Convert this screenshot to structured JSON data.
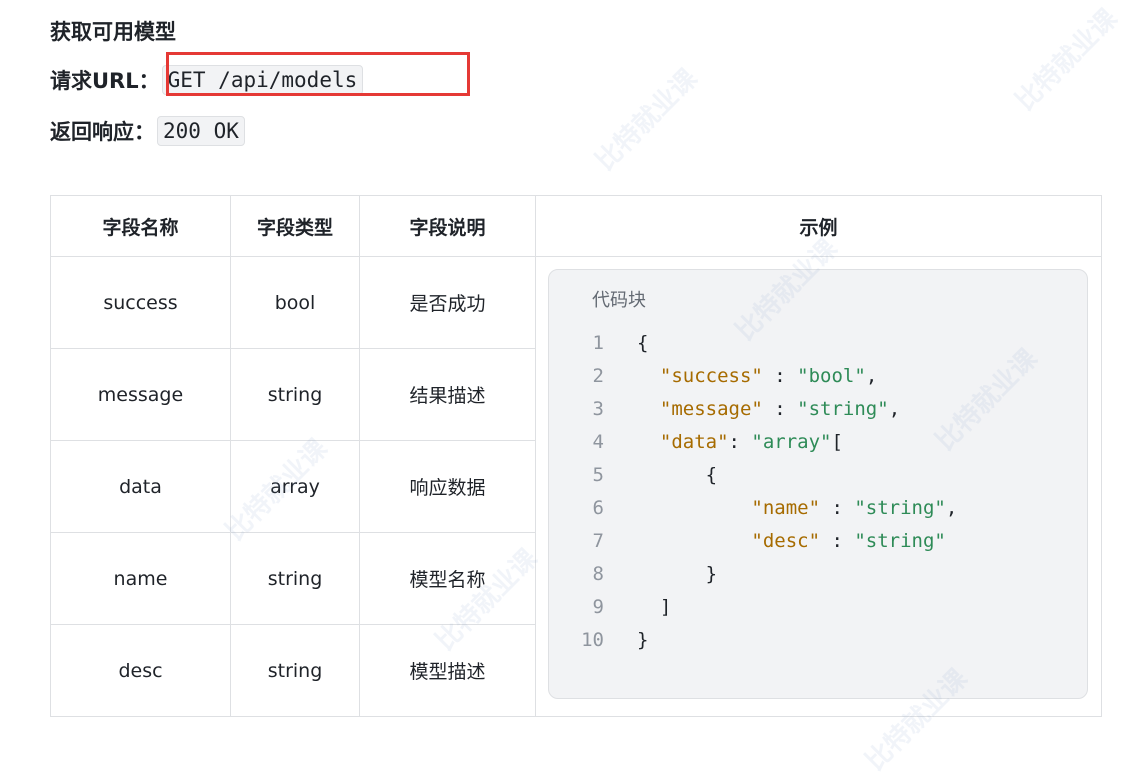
{
  "heading": "获取可用模型",
  "request": {
    "label": "请求URL：",
    "value": "GET /api/models"
  },
  "response": {
    "label": "返回响应：",
    "value": "200 OK"
  },
  "table": {
    "headers": [
      "字段名称",
      "字段类型",
      "字段说明",
      "示例"
    ],
    "rows": [
      [
        "success",
        "bool",
        "是否成功"
      ],
      [
        "message",
        "string",
        "结果描述"
      ],
      [
        "data",
        "array",
        "响应数据"
      ],
      [
        "name",
        "string",
        "模型名称"
      ],
      [
        "desc",
        "string",
        "模型描述"
      ]
    ]
  },
  "code_block": {
    "title": "代码块",
    "lines": [
      {
        "n": "1",
        "tokens": [
          {
            "t": "{",
            "c": "punc"
          }
        ]
      },
      {
        "n": "2",
        "tokens": [
          {
            "t": "  ",
            "c": "punc"
          },
          {
            "t": "\"success\"",
            "c": "str"
          },
          {
            "t": " : ",
            "c": "punc"
          },
          {
            "t": "\"bool\"",
            "c": "green"
          },
          {
            "t": ",",
            "c": "punc"
          }
        ]
      },
      {
        "n": "3",
        "tokens": [
          {
            "t": "  ",
            "c": "punc"
          },
          {
            "t": "\"message\"",
            "c": "str"
          },
          {
            "t": " : ",
            "c": "punc"
          },
          {
            "t": "\"string\"",
            "c": "green"
          },
          {
            "t": ",",
            "c": "punc"
          }
        ]
      },
      {
        "n": "4",
        "tokens": [
          {
            "t": "  ",
            "c": "punc"
          },
          {
            "t": "\"data\"",
            "c": "str"
          },
          {
            "t": ": ",
            "c": "punc"
          },
          {
            "t": "\"array\"",
            "c": "green"
          },
          {
            "t": "[",
            "c": "punc"
          }
        ]
      },
      {
        "n": "5",
        "tokens": [
          {
            "t": "      {",
            "c": "punc"
          }
        ]
      },
      {
        "n": "6",
        "tokens": [
          {
            "t": "          ",
            "c": "punc"
          },
          {
            "t": "\"name\"",
            "c": "str"
          },
          {
            "t": " : ",
            "c": "punc"
          },
          {
            "t": "\"string\"",
            "c": "green"
          },
          {
            "t": ",",
            "c": "punc"
          }
        ]
      },
      {
        "n": "7",
        "tokens": [
          {
            "t": "          ",
            "c": "punc"
          },
          {
            "t": "\"desc\"",
            "c": "str"
          },
          {
            "t": " : ",
            "c": "punc"
          },
          {
            "t": "\"string\"",
            "c": "green"
          }
        ]
      },
      {
        "n": "8",
        "tokens": [
          {
            "t": "      }",
            "c": "punc"
          }
        ]
      },
      {
        "n": "9",
        "tokens": [
          {
            "t": "  ]",
            "c": "punc"
          }
        ]
      },
      {
        "n": "10",
        "tokens": [
          {
            "t": "}",
            "c": "punc"
          }
        ]
      }
    ]
  },
  "watermark": "比特就业课"
}
